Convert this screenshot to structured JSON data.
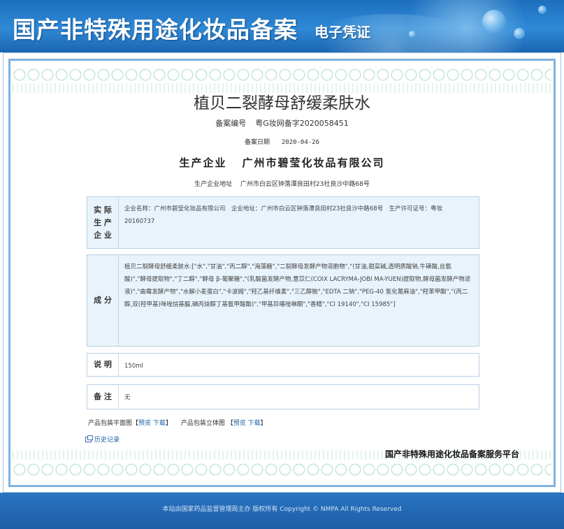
{
  "header": {
    "title": "国产非特殊用途化妆品备案",
    "subtitle": "电子凭证"
  },
  "product": {
    "name": "植贝二裂酵母舒缓柔肤水",
    "filing_no_label": "备案编号",
    "filing_no": "粤G妆网备字2020058451",
    "filing_date_label": "备案日期",
    "filing_date": "2020-04-26",
    "producer_label": "生产企业",
    "producer": "广州市碧莹化妆品有限公司",
    "address_label": "生产企业地址",
    "address": "广州市白云区钟落潭良田村23社良沙中路68号"
  },
  "sections": {
    "actual": {
      "label": "实际生产企业",
      "label_lines": [
        "实 际",
        "生 产",
        "企 业"
      ],
      "text": "企业名称：广州市碧莹化妆品有限公司　企业地址：广州市白云区钟落潭良田村23社良沙中路68号　生产许可证号：粤妆20160737"
    },
    "composition": {
      "label": "成 分",
      "text": "植贝二裂酵母舒缓柔肤水:[\"水\",\"甘油\",\"丙二醇\",\"海藻糖\",\"二裂酵母发酵产物溶胞物\",\"(甘油,甜菜碱,透明质酸钠,牛磺酸,丝氨酸)\",\"酵母提取物\",\"丁二醇\",\"酵母 β-葡聚糖\",\"(乳酸菌发酵产物,薏苡仁(COIX LACRYMA-JOBI MA-YUEN)提取物,酵母菌发酵产物滤液)\",\"曲霉发酵产物\",\"水解小麦蛋白\",\"卡波姆\",\"羟乙基纤维素\",\"三乙醇胺\",\"EDTA 二钠\",\"PEG-40 氢化蓖麻油\",\"羟苯甲酯\",\"(丙二醇,双(羟甲基)咪唑烷基脲,碘丙炔醇丁基氨甲酸酯)\",\"甲基异噻唑啉酮\",\"香精\",\"CI 19140\",\"CI 15985\"]"
    },
    "note": {
      "label": "说 明",
      "text": "150ml"
    },
    "remark": {
      "label": "备 注",
      "text": "无"
    }
  },
  "links": {
    "flat_label": "产品包装平面图",
    "flat_preview": "预览",
    "flat_download": "下载",
    "solid_label": "产品包装立体图",
    "solid_preview": "预览",
    "solid_download": "下载",
    "history": "历史记录"
  },
  "platform": "国产非特殊用途化妆品备案服务平台",
  "footer": {
    "text": "本站由国家药品监督管理局主办 版权所有 Copyright © NMPA All Rights Reserved"
  },
  "colors": {
    "banner": "#2f8ad6",
    "frame": "#7fb3de",
    "box_fill": "#e8f3fb",
    "link": "#1a5fa8",
    "footer": "#1d5ea6"
  }
}
